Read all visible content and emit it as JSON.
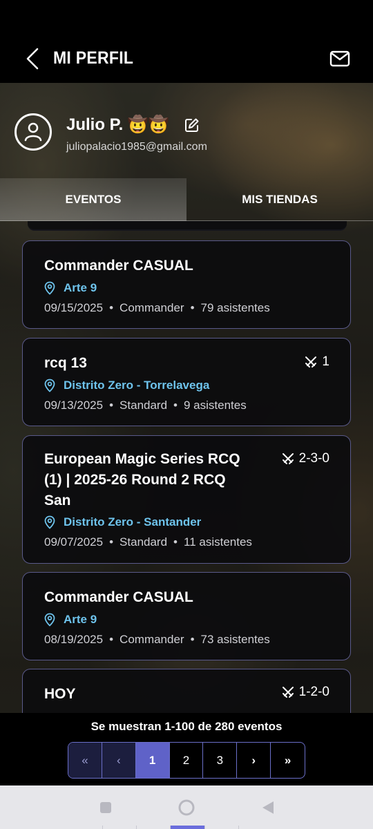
{
  "header": {
    "title": "MI PERFIL",
    "back_icon": "chevron-left-icon",
    "mail_icon": "envelope-icon"
  },
  "profile": {
    "name": "Julio P. 🤠🤠",
    "email": "juliopalacio1985@gmail.com",
    "avatar_icon": "user-circle-icon",
    "edit_icon": "pencil-square-icon"
  },
  "tabs": [
    {
      "label": "EVENTOS",
      "active": true
    },
    {
      "label": "MIS TIENDAS",
      "active": false
    }
  ],
  "events": [
    {
      "title_lines": [
        "Commander CASUAL"
      ],
      "location": "Arte 9",
      "date": "09/15/2025",
      "format": "Commander",
      "attendees": "79 asistentes",
      "record": ""
    },
    {
      "title_lines": [
        "rcq 13"
      ],
      "location": "Distrito Zero - Torrelavega",
      "date": "09/13/2025",
      "format": "Standard",
      "attendees": "9 asistentes",
      "record": "1"
    },
    {
      "title_lines": [
        "European Magic Series RCQ",
        "(1) | 2025-26 Round 2 RCQ",
        "San"
      ],
      "location": "Distrito Zero - Santander",
      "date": "09/07/2025",
      "format": "Standard",
      "attendees": "11 asistentes",
      "record": "2-3-0"
    },
    {
      "title_lines": [
        "Commander CASUAL"
      ],
      "location": "Arte 9",
      "date": "08/19/2025",
      "format": "Commander",
      "attendees": "73 asistentes",
      "record": ""
    },
    {
      "title_lines": [
        "HOY"
      ],
      "location": "",
      "date": "",
      "format": "",
      "attendees": "",
      "record": "1-2-0"
    }
  ],
  "separator": "•",
  "pagination": {
    "info": "Se muestran 1-100 de 280 eventos",
    "first": "«",
    "prev": "‹",
    "pages": [
      "1",
      "2",
      "3"
    ],
    "current": "1",
    "next": "›",
    "last": "»"
  },
  "colors": {
    "accent": "#5f62c8",
    "location_blue": "#6ec3ec",
    "card_border": "#5a5a8a"
  }
}
